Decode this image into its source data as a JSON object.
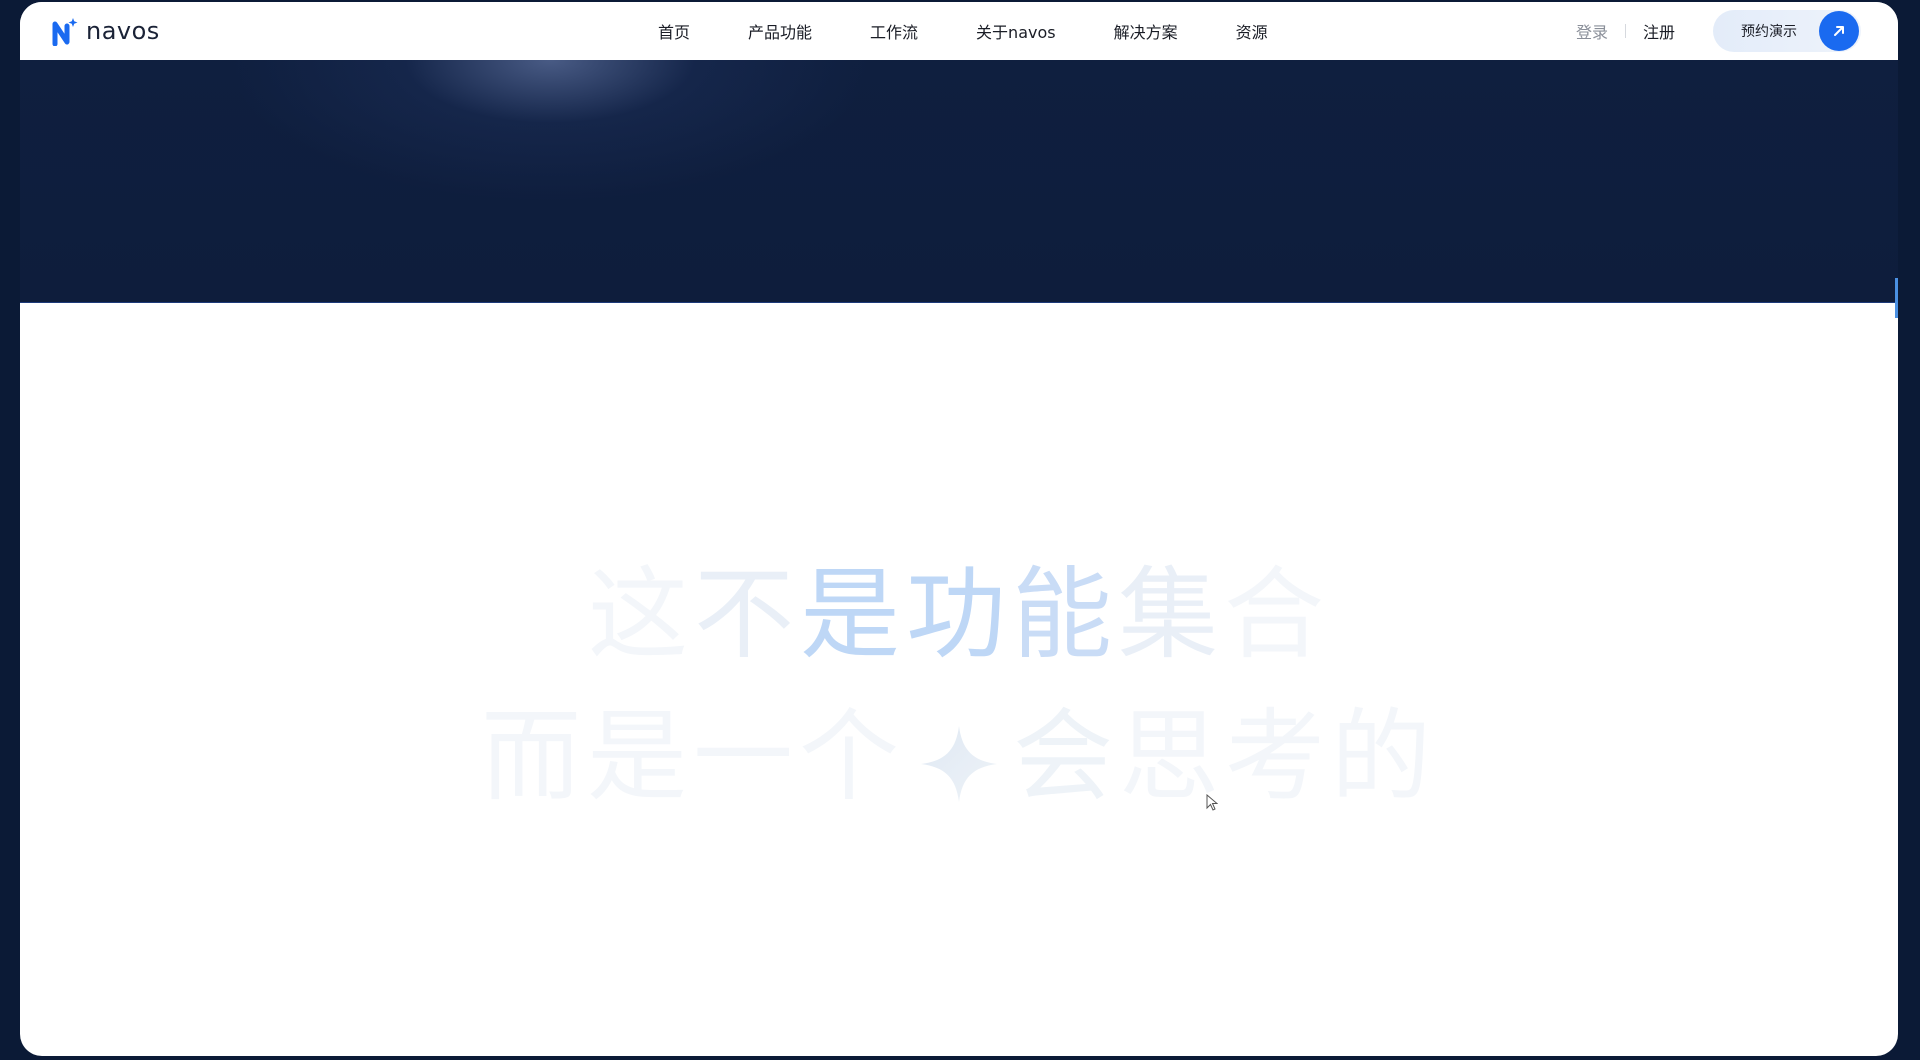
{
  "brand": {
    "name": "navos",
    "accent": "#1a6af0"
  },
  "nav": {
    "items": [
      {
        "label": "首页"
      },
      {
        "label": "产品功能"
      },
      {
        "label": "工作流"
      },
      {
        "label": "关于navos"
      },
      {
        "label": "解决方案"
      },
      {
        "label": "资源"
      }
    ],
    "login_label": "登录",
    "register_label": "注册",
    "demo_label": "预约演示",
    "demo_icon": "arrow-up-right-icon"
  },
  "hero": {
    "line1": [
      "这",
      "不",
      "是",
      "功",
      "能",
      "集",
      "合"
    ],
    "line2_before": [
      "而",
      "是",
      "一",
      "个"
    ],
    "line2_icon": "sparkle-icon",
    "line2_after": [
      "会",
      "思",
      "考",
      "的"
    ]
  }
}
